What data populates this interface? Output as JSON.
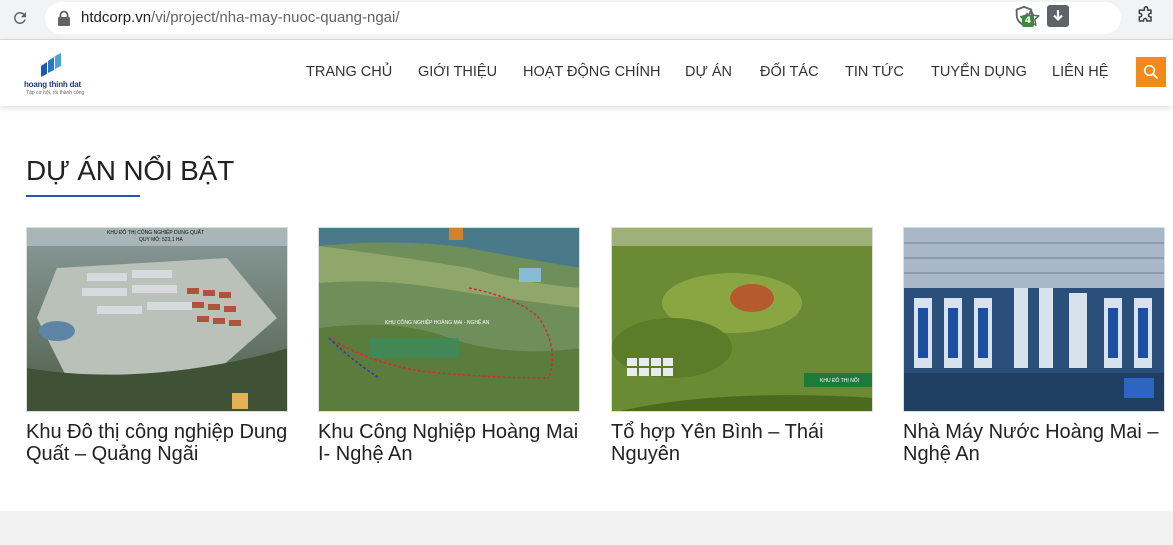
{
  "browser": {
    "url_host": "htdcorp.vn",
    "url_path": "/vi/project/nha-may-nuoc-quang-ngai/",
    "extension_badge": "4",
    "icons": [
      "reload-icon",
      "lock-icon",
      "star-icon",
      "shield-extension-icon",
      "download-extension-icon",
      "puzzle-icon"
    ]
  },
  "site": {
    "logo_name": "hoang thinh dat",
    "logo_tagline": "Tập cơ hội, rồi thành công",
    "nav": [
      {
        "label": "TRANG CHỦ"
      },
      {
        "label": "GIỚI THIỆU"
      },
      {
        "label": "HOẠT ĐỘNG CHÍNH"
      },
      {
        "label": "DỰ ÁN"
      },
      {
        "label": "ĐỐI TÁC"
      },
      {
        "label": "TIN TỨC"
      },
      {
        "label": "TUYỂN DỤNG"
      },
      {
        "label": "LIÊN HỆ"
      }
    ],
    "colors": {
      "accent": "#f28a1b",
      "underline": "#1e5aa8",
      "text": "#222222"
    }
  },
  "section": {
    "title": "DỰ ÁN NỔI BẬT",
    "projects": [
      {
        "title": "Khu Đô thị công nghiệp Dung Quất – Quảng Ngãi",
        "img_caption": "KHU ĐÔ THỊ CÔNG NGHIỆP DUNG QUẤT",
        "img_subcaption": "QUY MÔ: 523,1 HA"
      },
      {
        "title": "Khu Công Nghiệp Hoàng Mai I- Nghệ An",
        "img_caption": "KHU CÔNG NGHIỆP HOÀNG MAI - NGHỆ AN"
      },
      {
        "title": "Tổ hợp Yên Bình – Thái Nguyên",
        "img_caption": "KHU ĐÔ THỊ NỐI"
      },
      {
        "title": "Nhà Máy Nước Hoàng Mai – Nghệ An"
      }
    ]
  }
}
